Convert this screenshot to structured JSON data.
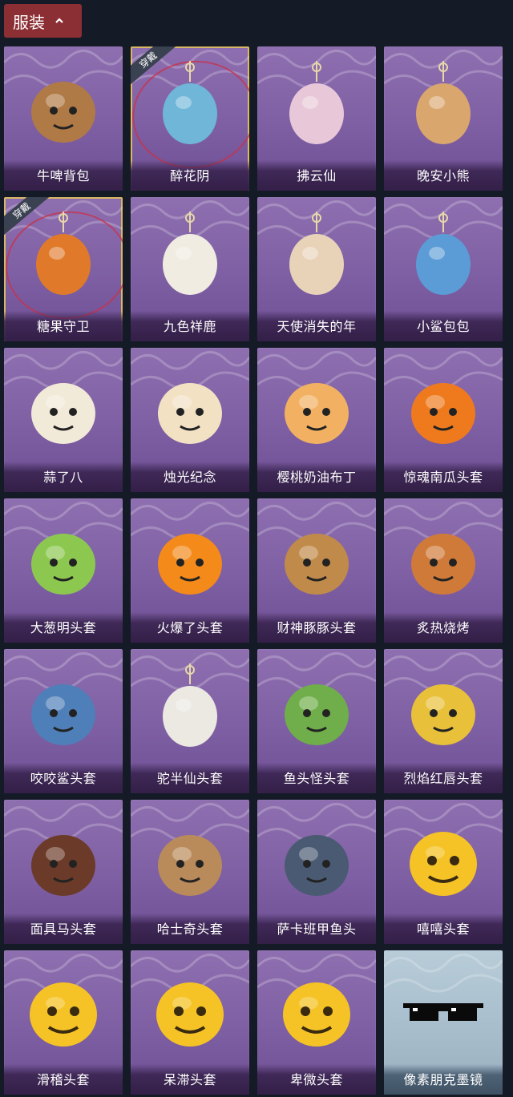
{
  "header": {
    "tab_label": "服装"
  },
  "badge_text": "穿戴",
  "items": [
    {
      "name": "牛啤背包",
      "equipped": false,
      "rarity": "purple",
      "icon": "cow-beer-backpack-icon",
      "color": "#b07a46"
    },
    {
      "name": "醉花阴",
      "equipped": true,
      "rarity": "purple",
      "icon": "flower-dreamcatcher-icon",
      "color": "#6fb6d8"
    },
    {
      "name": "拂云仙",
      "equipped": false,
      "rarity": "purple",
      "icon": "fairy-pendant-icon",
      "color": "#e8c8d8"
    },
    {
      "name": "晚安小熊",
      "equipped": false,
      "rarity": "purple",
      "icon": "teddy-bear-icon",
      "color": "#d9a66e"
    },
    {
      "name": "糖果守卫",
      "equipped": true,
      "rarity": "purple",
      "icon": "pumpkin-scarecrow-icon",
      "color": "#e07a2a"
    },
    {
      "name": "九色祥鹿",
      "equipped": false,
      "rarity": "purple",
      "icon": "deer-pendant-icon",
      "color": "#f0ece2"
    },
    {
      "name": "天使消失的年",
      "equipped": false,
      "rarity": "purple",
      "icon": "angel-doll-icon",
      "color": "#e8d2b8"
    },
    {
      "name": "小鲨包包",
      "equipped": false,
      "rarity": "purple",
      "icon": "shark-bag-icon",
      "color": "#5b9bd6"
    },
    {
      "name": "蒜了八",
      "equipped": false,
      "rarity": "purple",
      "icon": "garlic-head-icon",
      "color": "#f2ead8"
    },
    {
      "name": "烛光纪念",
      "equipped": false,
      "rarity": "purple",
      "icon": "candle-head-icon",
      "color": "#f3e1c4"
    },
    {
      "name": "樱桃奶油布丁",
      "equipped": false,
      "rarity": "purple",
      "icon": "pudding-head-icon",
      "color": "#f2b062"
    },
    {
      "name": "惊魂南瓜头套",
      "equipped": false,
      "rarity": "purple",
      "icon": "pumpkin-head-icon",
      "color": "#ef7a1e"
    },
    {
      "name": "大葱明头套",
      "equipped": false,
      "rarity": "purple",
      "icon": "green-onion-head-icon",
      "color": "#8cc850"
    },
    {
      "name": "火爆了头套",
      "equipped": false,
      "rarity": "purple",
      "icon": "fireball-head-icon",
      "color": "#f38a1a"
    },
    {
      "name": "财神豚豚头套",
      "equipped": false,
      "rarity": "purple",
      "icon": "capybara-head-icon",
      "color": "#c08a4a"
    },
    {
      "name": "炙热烧烤",
      "equipped": false,
      "rarity": "purple",
      "icon": "bbq-meat-head-icon",
      "color": "#d07a3a"
    },
    {
      "name": "咬咬鲨头套",
      "equipped": false,
      "rarity": "purple",
      "icon": "shark-head-icon",
      "color": "#4f7fb8"
    },
    {
      "name": "驼半仙头套",
      "equipped": false,
      "rarity": "purple",
      "icon": "panda-bear-head-icon",
      "color": "#ece8e2"
    },
    {
      "name": "鱼头怪头套",
      "equipped": false,
      "rarity": "purple",
      "icon": "fish-mask-icon",
      "color": "#6fae4a"
    },
    {
      "name": "烈焰红唇头套",
      "equipped": false,
      "rarity": "purple",
      "icon": "yellow-mask-icon",
      "color": "#e8c03a"
    },
    {
      "name": "面具马头套",
      "equipped": false,
      "rarity": "purple",
      "icon": "horse-head-icon",
      "color": "#6b3a28"
    },
    {
      "name": "哈士奇头套",
      "equipped": false,
      "rarity": "purple",
      "icon": "husky-head-icon",
      "color": "#b98a5a"
    },
    {
      "name": "萨卡班甲鱼头",
      "equipped": false,
      "rarity": "purple",
      "icon": "fish-head-icon",
      "color": "#4a5a72"
    },
    {
      "name": "嘻嘻头套",
      "equipped": false,
      "rarity": "purple",
      "icon": "grin-emoji-head-icon",
      "color": "#f5c326"
    },
    {
      "name": "滑稽头套",
      "equipped": false,
      "rarity": "purple",
      "icon": "smirk-emoji-head-icon",
      "color": "#f5c326"
    },
    {
      "name": "呆滞头套",
      "equipped": false,
      "rarity": "purple",
      "icon": "stare-emoji-head-icon",
      "color": "#f5c326"
    },
    {
      "name": "卑微头套",
      "equipped": false,
      "rarity": "purple",
      "icon": "humble-emoji-head-icon",
      "color": "#f5c326"
    },
    {
      "name": "像素朋克墨镜",
      "equipped": false,
      "rarity": "blue",
      "icon": "pixel-sunglasses-icon",
      "color": "#111111"
    }
  ]
}
